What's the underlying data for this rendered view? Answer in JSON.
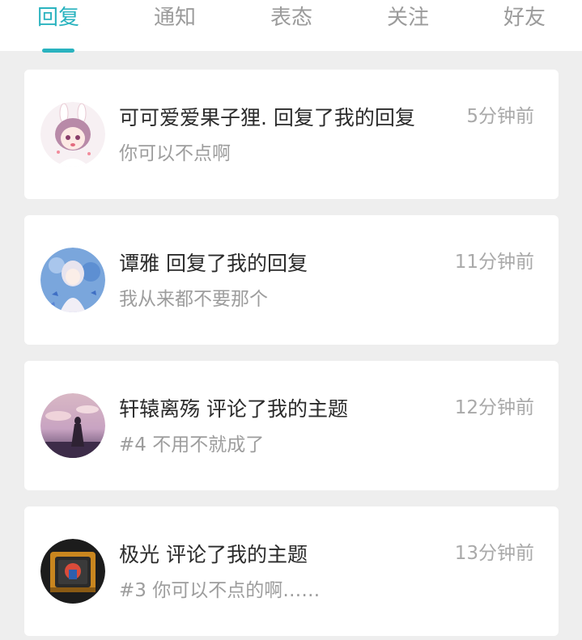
{
  "tabs": [
    {
      "label": "回复",
      "active": true
    },
    {
      "label": "通知",
      "active": false
    },
    {
      "label": "表态",
      "active": false
    },
    {
      "label": "关注",
      "active": false
    },
    {
      "label": "好友",
      "active": false
    }
  ],
  "colors": {
    "accent": "#2ab3bf",
    "background": "#eeeeee",
    "card": "#ffffff",
    "title_text": "#2b2b2b",
    "secondary_text": "#9d9d9d"
  },
  "messages": [
    {
      "avatar_icon": "anime-girl-bunny-ears-avatar",
      "title": "可可爱爱果子狸. 回复了我的回复",
      "time": "5分钟前",
      "snippet": "你可以不点啊"
    },
    {
      "avatar_icon": "anime-girl-blue-butterflies-avatar",
      "title": "谭雅 回复了我的回复",
      "time": "11分钟前",
      "snippet": "我从来都不要那个"
    },
    {
      "avatar_icon": "girl-silhouette-sunset-avatar",
      "title": "轩辕离殇 评论了我的主题",
      "time": "12分钟前",
      "snippet": "#4 不用不就成了"
    },
    {
      "avatar_icon": "game-character-emblem-avatar",
      "title": "极光 评论了我的主题",
      "time": "13分钟前",
      "snippet": "#3 你可以不点的啊……"
    }
  ]
}
